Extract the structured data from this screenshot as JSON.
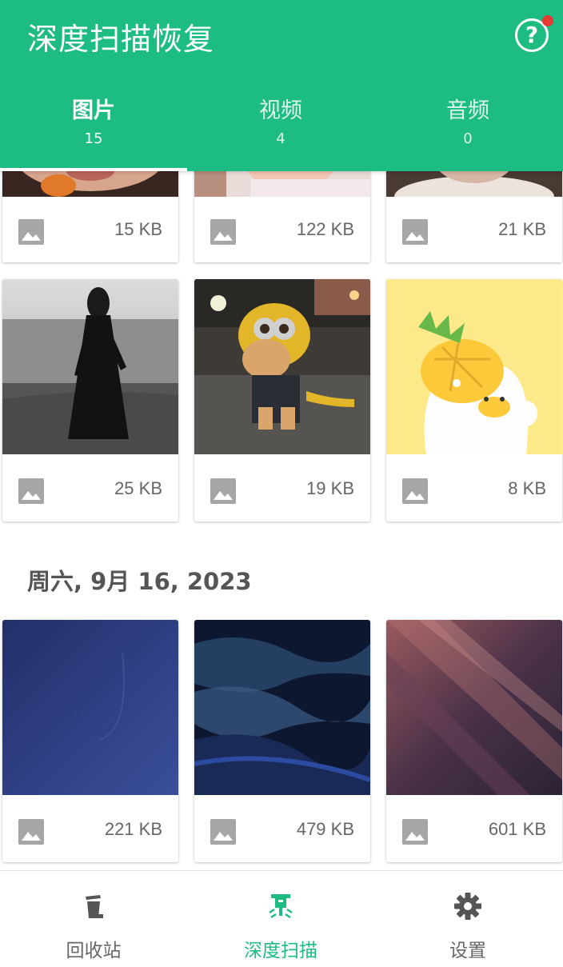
{
  "header": {
    "title": "深度扫描恢复",
    "help_icon": "help-circle-icon",
    "accent": "#1dbc82",
    "notif_color": "#e53935"
  },
  "tabs": [
    {
      "label": "图片",
      "count": "15",
      "active": true
    },
    {
      "label": "视频",
      "count": "4",
      "active": false
    },
    {
      "label": "音频",
      "count": "0",
      "active": false
    }
  ],
  "sections": [
    {
      "items": [
        {
          "size": "15 KB",
          "thumb": "photo of person with orange (partially scrolled)"
        },
        {
          "size": "122 KB",
          "thumb": "photo of child (partially scrolled)"
        },
        {
          "size": "21 KB",
          "thumb": "photo (partially scrolled)"
        },
        {
          "size": "25 KB",
          "thumb": "black and white photo of woman in black dress on a beach"
        },
        {
          "size": "19 KB",
          "thumb": "cat wearing a minion costume on a street at night"
        },
        {
          "size": "8 KB",
          "thumb": "cartoon white duck wearing a pineapple hat"
        }
      ]
    },
    {
      "date": "周六, 9月 16, 2023",
      "items": [
        {
          "size": "221 KB",
          "thumb": "blue gradient wallpaper"
        },
        {
          "size": "479 KB",
          "thumb": "dark blue fluid waves wallpaper"
        },
        {
          "size": "601 KB",
          "thumb": "purple diagonal light streaks wallpaper"
        }
      ]
    }
  ],
  "bottom_nav": [
    {
      "label": "回收站",
      "icon": "trash-icon",
      "active": false
    },
    {
      "label": "深度扫描",
      "icon": "drill-icon",
      "active": true
    },
    {
      "label": "设置",
      "icon": "gear-icon",
      "active": false
    }
  ]
}
